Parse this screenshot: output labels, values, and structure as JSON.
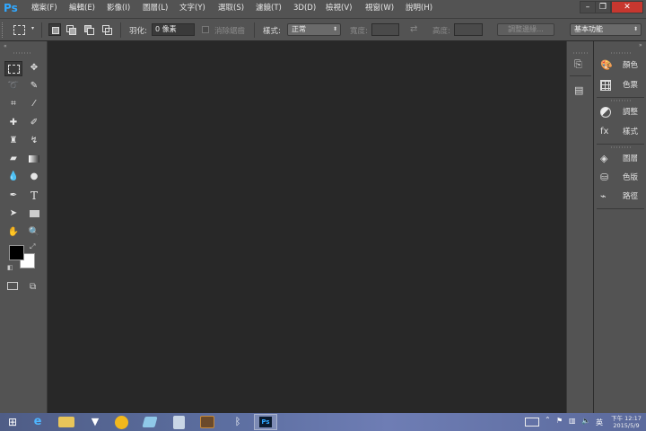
{
  "app": {
    "logo": "Ps"
  },
  "menu": [
    {
      "label": "檔案(F)"
    },
    {
      "label": "編輯(E)"
    },
    {
      "label": "影像(I)"
    },
    {
      "label": "圖層(L)"
    },
    {
      "label": "文字(Y)"
    },
    {
      "label": "選取(S)"
    },
    {
      "label": "濾鏡(T)"
    },
    {
      "label": "3D(D)"
    },
    {
      "label": "檢視(V)"
    },
    {
      "label": "視窗(W)"
    },
    {
      "label": "說明(H)"
    }
  ],
  "window_controls": {
    "minimize": "–",
    "restore": "❐",
    "close": "✕"
  },
  "options": {
    "feather_label": "羽化:",
    "feather_value": "0 像素",
    "antialias_label": "消除鋸齒",
    "style_label": "樣式:",
    "style_value": "正常",
    "width_label": "寬度:",
    "height_label": "高度:",
    "refine_edge": "調整邊緣...",
    "workspace": "基本功能"
  },
  "panels": {
    "group1": [
      {
        "label": "顏色",
        "icon": "palette-icon"
      },
      {
        "label": "色票",
        "icon": "swatches-grid-icon"
      }
    ],
    "group2": [
      {
        "label": "調整",
        "icon": "adjustments-icon"
      },
      {
        "label": "樣式",
        "icon": "styles-icon"
      }
    ],
    "group3": [
      {
        "label": "圖層",
        "icon": "layers-icon"
      },
      {
        "label": "色版",
        "icon": "channels-icon"
      },
      {
        "label": "路徑",
        "icon": "paths-icon"
      }
    ]
  },
  "taskbar": {
    "ime": "英",
    "time": "下午 12:17",
    "date": "2015/5/9"
  },
  "colors": {
    "foreground": "#000000",
    "background": "#ffffff",
    "accent": "#31a8ff"
  }
}
